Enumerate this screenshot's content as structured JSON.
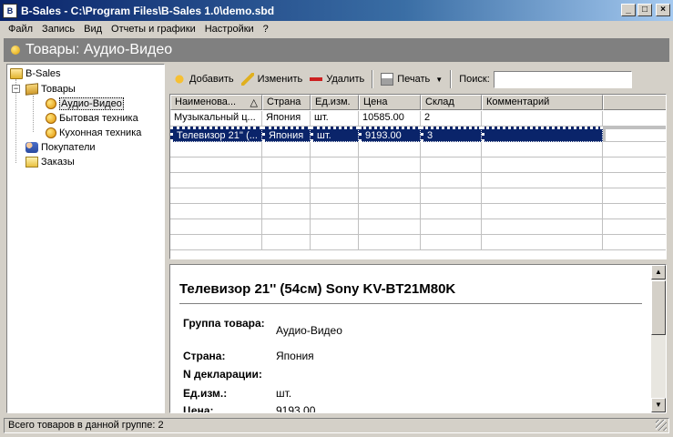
{
  "window": {
    "title": "B-Sales - C:\\Program Files\\B-Sales 1.0\\demo.sbd",
    "app_icon_text": "B",
    "min": "_",
    "max": "□",
    "close": "×"
  },
  "menu": [
    "Файл",
    "Запись",
    "Вид",
    "Отчеты и графики",
    "Настройки",
    "?"
  ],
  "header": {
    "title": "Товары: Аудио-Видео"
  },
  "tree": {
    "root": "B-Sales",
    "goods": "Товары",
    "audio_video": "Аудио-Видео",
    "home_appliances": "Бытовая техника",
    "kitchen": "Кухонная техника",
    "customers": "Покупатели",
    "orders": "Заказы",
    "expander": "−"
  },
  "toolbar": {
    "add": "Добавить",
    "edit": "Изменить",
    "delete": "Удалить",
    "print": "Печать",
    "dropdown": "▼",
    "search_label": "Поиск:",
    "search_value": ""
  },
  "grid": {
    "columns": [
      "Наименова...",
      "Страна",
      "Ед.изм.",
      "Цена",
      "Склад",
      "Комментарий"
    ],
    "sort_indicator": "△",
    "rows": [
      [
        "Музыкальный ц...",
        "Япония",
        "шт.",
        "10585.00",
        "2",
        ""
      ],
      [
        "Телевизор 21'' (...",
        "Япония",
        "шт.",
        "9193.00",
        "3",
        ""
      ]
    ],
    "selected_row": 1
  },
  "detail": {
    "title": "Телевизор 21'' (54см) Sony KV-BT21M80K",
    "fields": [
      {
        "label": "Группа товара:",
        "value": "Аудио-Видео"
      },
      {
        "label": "Страна:",
        "value": "Япония"
      },
      {
        "label": "N декларации:",
        "value": ""
      },
      {
        "label": "Ед.изм.:",
        "value": "шт."
      },
      {
        "label": "Цена:",
        "value": "9193.00"
      }
    ],
    "scroll_up": "▲",
    "scroll_down": "▼"
  },
  "status": {
    "text": "Всего товаров в данной группе: 2"
  }
}
